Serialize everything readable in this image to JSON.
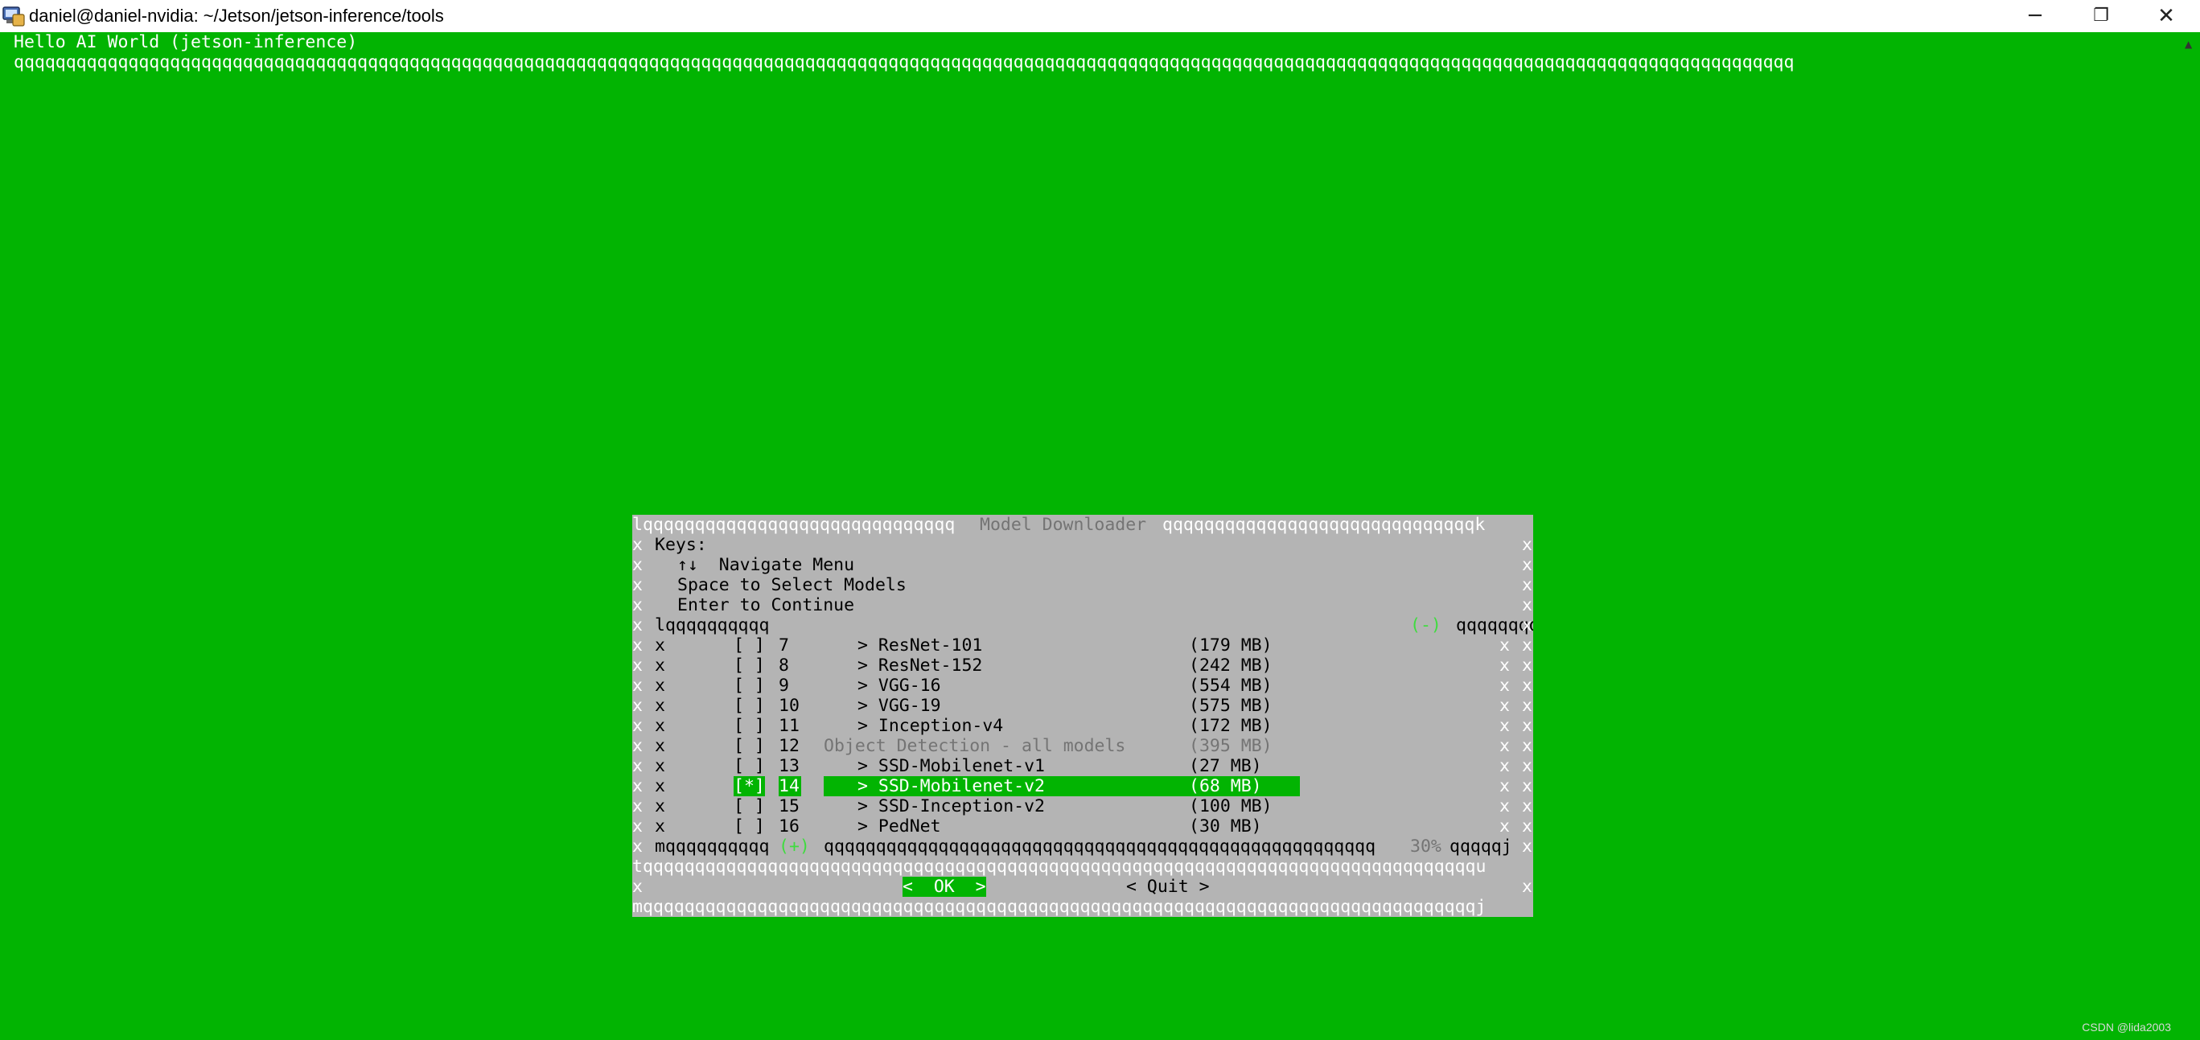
{
  "window": {
    "title": "daniel@daniel-nvidia: ~/Jetson/jetson-inference/tools",
    "minimize_glyph": "─",
    "restore_glyph": "❐",
    "close_glyph": "✕",
    "icon": "terminal-app-icon"
  },
  "terminal": {
    "header_text": "Hello AI World (jetson-inference)",
    "header_rule": "qqqqqqqqqqqqqqqqqqqqqqqqqqqqqqqqqqqqqqqqqqqqqqqqqqqqqqqqqqqqqqqqqqqqqqqqqqqqqqqqqqqqqqqqqqqqqqqqqqqqqqqqqqqqqqqqqqqqqqqqqqqqqqqqqqqqqqqqqqqqqqqqqqqqqqqqqqqqqqqqqqqqqqqqqqq",
    "background": "#02b402"
  },
  "dialog": {
    "border_left": "lqqqqqqqqqqqqqqqqqqqqqqqqqqqqqq",
    "title": "Model Downloader",
    "border_right": "qqqqqqqqqqqqqqqqqqqqqqqqqqqqqqk",
    "keys_heading": "Keys:",
    "key_navigate": "↑↓  Navigate Menu",
    "key_space": "Space to Select Models",
    "key_enter": "Enter to Continue",
    "list_border_top_left": "lqqqqqqqqqq",
    "list_border_top_mid": "(-)",
    "list_border_top_right": "qqqqqqqqqqqqqqqqqqqqqqqqqqqqqqqqqqqqqqqqqqqqqqqqqqqqqqqqqqqqqk",
    "items": [
      {
        "check": "[ ]",
        "num": "7",
        "name": "> ResNet-101",
        "size": "(179 MB)"
      },
      {
        "check": "[ ]",
        "num": "8",
        "name": "> ResNet-152",
        "size": "(242 MB)"
      },
      {
        "check": "[ ]",
        "num": "9",
        "name": "> VGG-16",
        "size": "(554 MB)"
      },
      {
        "check": "[ ]",
        "num": "10",
        "name": "> VGG-19",
        "size": "(575 MB)"
      },
      {
        "check": "[ ]",
        "num": "11",
        "name": "> Inception-v4",
        "size": "(172 MB)"
      },
      {
        "check": "[ ]",
        "num": "12",
        "name": "Object Detection - all models",
        "size": "(395 MB)"
      },
      {
        "check": "[ ]",
        "num": "13",
        "name": "> SSD-Mobilenet-v1",
        "size": "(27 MB)"
      },
      {
        "check": "[*]",
        "num": "14",
        "name": "> SSD-Mobilenet-v2",
        "size": "(68 MB)"
      },
      {
        "check": "[ ]",
        "num": "15",
        "name": "> SSD-Inception-v2",
        "size": "(100 MB)"
      },
      {
        "check": "[ ]",
        "num": "16",
        "name": "> PedNet",
        "size": "(30 MB)"
      }
    ],
    "list_border_bottom_left": "mqqqqqqqqqq",
    "list_border_bottom_mid": "(+)",
    "list_border_bottom_right": "qqqqqqqqqqqqqqqqqqqqqqqqqqqqqqqqqqqqqqqqqqqqqqqqqqqqq",
    "scroll_percent": "30%",
    "list_border_bottom_end": "qqqqqj",
    "separator": "tqqqqqqqqqqqqqqqqqqqqqqqqqqqqqqqqqqqqqqqqqqqqqqqqqqqqqqqqqqqqqqqqqqqqqqqqqqqqqqqqu",
    "ok_label": "<  OK  >",
    "quit_label": "< Quit >",
    "border_bottom": "mqqqqqqqqqqqqqqqqqqqqqqqqqqqqqqqqqqqqqqqqqqqqqqqqqqqqqqqqqqqqqqqqqqqqqqqqqqqqqqqqj",
    "side_char": "x"
  },
  "watermark": "CSDN @lida2003"
}
